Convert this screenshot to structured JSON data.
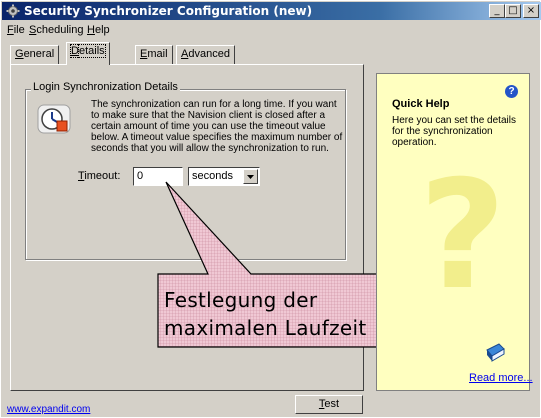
{
  "window": {
    "title": "Security Synchronizer Configuration (new)",
    "buttons": {
      "minimize": "_",
      "maximize": "□",
      "close": "×"
    }
  },
  "menu": [
    {
      "mnemonic": "F",
      "rest": "ile"
    },
    {
      "mnemonic": "S",
      "rest": "cheduling"
    },
    {
      "mnemonic": "H",
      "rest": "elp"
    }
  ],
  "tabs": [
    {
      "mnemonic": "G",
      "rest": "eneral",
      "active": false
    },
    {
      "mnemonic": "D",
      "rest": "etails",
      "active": true
    },
    {
      "mnemonic": "E",
      "rest": "mail",
      "active": false
    },
    {
      "mnemonic": "A",
      "rest": "dvanced",
      "active": false
    }
  ],
  "details": {
    "group_label": "Login Synchronization Details",
    "info_text": "The synchronization can run for a long time. If you want to make sure that the Navision client is closed after a certain amount of time you can use the timeout value below. A timeout value specifies the maximum number of seconds that you will allow the synchronization to run.",
    "timeout_label_mnemonic": "T",
    "timeout_label_rest": "imeout:",
    "timeout_value": "0",
    "unit_value": "seconds"
  },
  "callout": {
    "line1": "Festlegung der",
    "line2": "maximalen Laufzeit"
  },
  "quick_help": {
    "title": "Quick Help",
    "text": "Here you can set the details for the synchronization operation.",
    "read_more": "Read more..."
  },
  "footer": {
    "link": "www.expandit.com",
    "test_mnemonic": "T",
    "test_rest": "est"
  },
  "colors": {
    "titlebar": "#0a246a",
    "help_bg": "#ffffc0",
    "callout_fill": "#e8b8c8",
    "link": "#0000ee"
  }
}
